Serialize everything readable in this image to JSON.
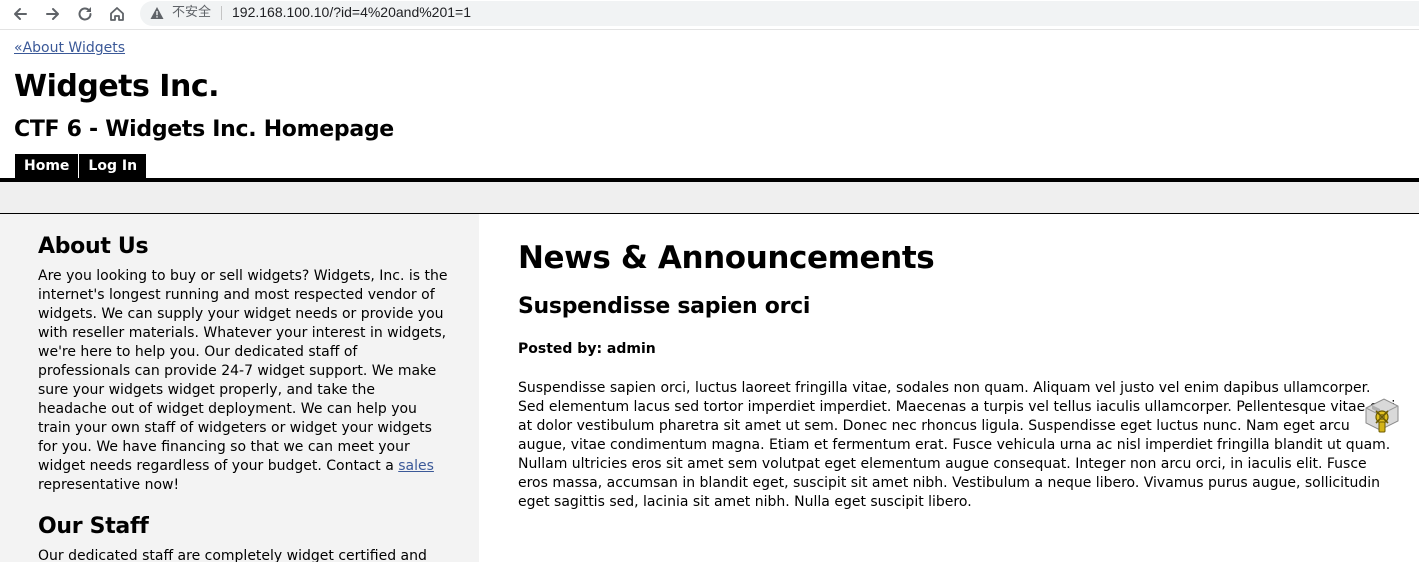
{
  "browser": {
    "nav_icons": [
      "back-arrow-icon",
      "forward-arrow-icon",
      "reload-icon",
      "home-icon"
    ],
    "security_icon": "warning-triangle-icon",
    "security_label": "不安全",
    "url": "192.168.100.10/?id=4%20and%201=1"
  },
  "header": {
    "back_link": "«About Widgets",
    "site_title": "Widgets Inc.",
    "site_subtitle": "CTF 6 - Widgets Inc. Homepage",
    "nav": [
      {
        "label": "Home"
      },
      {
        "label": "Log In"
      }
    ]
  },
  "sidebar": {
    "about": {
      "heading": "About Us",
      "text_before_link": "Are you looking to buy or sell widgets? Widgets, Inc. is the internet's longest running and most respected vendor of widgets. We can supply your widget needs or provide you with reseller materials. Whatever your interest in widgets, we're here to help you. Our dedicated staff of professionals can provide 24-7 widget support. We make sure your widgets widget properly, and take the headache out of widget deployment. We can help you train your own staff of widgeters or widget your widgets for you. We have financing so that we can meet your widget needs regardless of your budget. Contact a ",
      "link": "sales",
      "text_after_link": " representative now!"
    },
    "staff": {
      "heading": "Our Staff",
      "text": "Our dedicated staff are completely widget certified and"
    }
  },
  "main": {
    "heading": "News & Announcements",
    "post": {
      "title": "Suspendisse sapien orci",
      "byline": "Posted by: admin",
      "body": "Suspendisse sapien orci, luctus laoreet fringilla vitae, sodales non quam. Aliquam vel justo vel enim dapibus ullamcorper. Sed elementum lacus sed tortor imperdiet imperdiet. Maecenas a turpis vel tellus iaculis ullamcorper. Pellentesque vitae orci at dolor vestibulum pharetra sit amet ut sem. Donec nec rhoncus ligula. Suspendisse eget luctus nunc. Nam eget arcu augue, vitae condimentum magna. Etiam et fermentum erat. Fusce vehicula urna ac nisl imperdiet fringilla blandit ut quam. Nullam ultricies eros sit amet sem volutpat eget elementum augue consequat. Integer non arcu orci, in iaculis elit. Fusce eros massa, accumsan in blandit eget, suscipit sit amet nibh. Vestibulum a neque libero. Vivamus purus augue, sollicitudin eget sagittis sed, lacinia sit amet nibh. Nulla eget suscipit libero."
    }
  },
  "overlay": {
    "icon": "widget-tool-icon"
  }
}
